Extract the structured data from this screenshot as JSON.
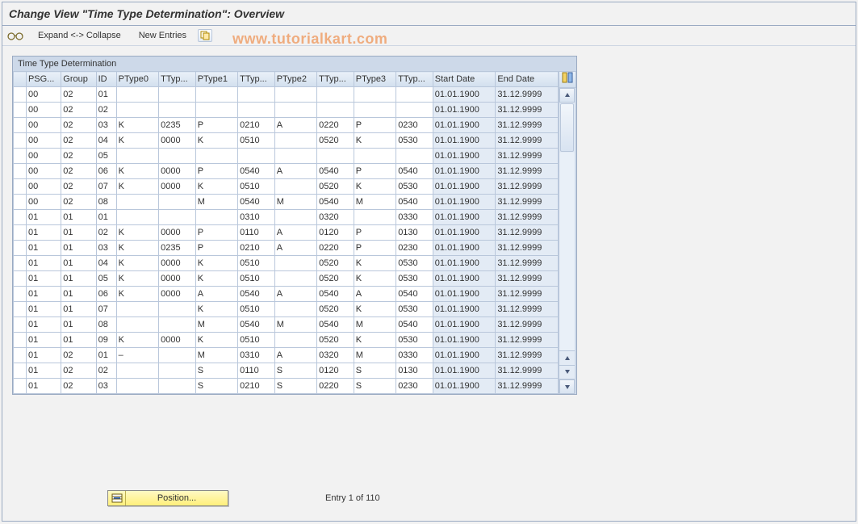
{
  "title": "Change View \"Time Type Determination\": Overview",
  "toolbar": {
    "expand_collapse": "Expand <-> Collapse",
    "new_entries": "New Entries"
  },
  "watermark": "www.tutorialkart.com",
  "panel_title": "Time Type Determination",
  "columns": [
    "PSG...",
    "Group",
    "ID",
    "PType0",
    "TTyp...",
    "PType1",
    "TTyp...",
    "PType2",
    "TTyp...",
    "PType3",
    "TTyp...",
    "Start Date",
    "End Date"
  ],
  "rows": [
    {
      "psg": "00",
      "group": "02",
      "id": "01",
      "pt0": "",
      "tt0": "",
      "pt1": "",
      "tt1": "",
      "pt2": "",
      "tt2": "",
      "pt3": "",
      "tt3": "",
      "start": "01.01.1900",
      "end": "31.12.9999"
    },
    {
      "psg": "00",
      "group": "02",
      "id": "02",
      "pt0": "",
      "tt0": "",
      "pt1": "",
      "tt1": "",
      "pt2": "",
      "tt2": "",
      "pt3": "",
      "tt3": "",
      "start": "01.01.1900",
      "end": "31.12.9999"
    },
    {
      "psg": "00",
      "group": "02",
      "id": "03",
      "pt0": "K",
      "tt0": "0235",
      "pt1": "P",
      "tt1": "0210",
      "pt2": "A",
      "tt2": "0220",
      "pt3": "P",
      "tt3": "0230",
      "start": "01.01.1900",
      "end": "31.12.9999"
    },
    {
      "psg": "00",
      "group": "02",
      "id": "04",
      "pt0": "K",
      "tt0": "0000",
      "pt1": "K",
      "tt1": "0510",
      "pt2": "",
      "tt2": "0520",
      "pt3": "K",
      "tt3": "0530",
      "start": "01.01.1900",
      "end": "31.12.9999"
    },
    {
      "psg": "00",
      "group": "02",
      "id": "05",
      "pt0": "",
      "tt0": "",
      "pt1": "",
      "tt1": "",
      "pt2": "",
      "tt2": "",
      "pt3": "",
      "tt3": "",
      "start": "01.01.1900",
      "end": "31.12.9999"
    },
    {
      "psg": "00",
      "group": "02",
      "id": "06",
      "pt0": "K",
      "tt0": "0000",
      "pt1": "P",
      "tt1": "0540",
      "pt2": "A",
      "tt2": "0540",
      "pt3": "P",
      "tt3": "0540",
      "start": "01.01.1900",
      "end": "31.12.9999"
    },
    {
      "psg": "00",
      "group": "02",
      "id": "07",
      "pt0": "K",
      "tt0": "0000",
      "pt1": "K",
      "tt1": "0510",
      "pt2": "",
      "tt2": "0520",
      "pt3": "K",
      "tt3": "0530",
      "start": "01.01.1900",
      "end": "31.12.9999"
    },
    {
      "psg": "00",
      "group": "02",
      "id": "08",
      "pt0": "",
      "tt0": "",
      "pt1": "M",
      "tt1": "0540",
      "pt2": "M",
      "tt2": "0540",
      "pt3": "M",
      "tt3": "0540",
      "start": "01.01.1900",
      "end": "31.12.9999"
    },
    {
      "psg": "01",
      "group": "01",
      "id": "01",
      "pt0": "",
      "tt0": "",
      "pt1": "",
      "tt1": "0310",
      "pt2": "",
      "tt2": "0320",
      "pt3": "",
      "tt3": "0330",
      "start": "01.01.1900",
      "end": "31.12.9999"
    },
    {
      "psg": "01",
      "group": "01",
      "id": "02",
      "pt0": "K",
      "tt0": "0000",
      "pt1": "P",
      "tt1": "0110",
      "pt2": "A",
      "tt2": "0120",
      "pt3": "P",
      "tt3": "0130",
      "start": "01.01.1900",
      "end": "31.12.9999"
    },
    {
      "psg": "01",
      "group": "01",
      "id": "03",
      "pt0": "K",
      "tt0": "0235",
      "pt1": "P",
      "tt1": "0210",
      "pt2": "A",
      "tt2": "0220",
      "pt3": "P",
      "tt3": "0230",
      "start": "01.01.1900",
      "end": "31.12.9999"
    },
    {
      "psg": "01",
      "group": "01",
      "id": "04",
      "pt0": "K",
      "tt0": "0000",
      "pt1": "K",
      "tt1": "0510",
      "pt2": "",
      "tt2": "0520",
      "pt3": "K",
      "tt3": "0530",
      "start": "01.01.1900",
      "end": "31.12.9999"
    },
    {
      "psg": "01",
      "group": "01",
      "id": "05",
      "pt0": "K",
      "tt0": "0000",
      "pt1": "K",
      "tt1": "0510",
      "pt2": "",
      "tt2": "0520",
      "pt3": "K",
      "tt3": "0530",
      "start": "01.01.1900",
      "end": "31.12.9999"
    },
    {
      "psg": "01",
      "group": "01",
      "id": "06",
      "pt0": "K",
      "tt0": "0000",
      "pt1": "A",
      "tt1": "0540",
      "pt2": "A",
      "tt2": "0540",
      "pt3": "A",
      "tt3": "0540",
      "start": "01.01.1900",
      "end": "31.12.9999"
    },
    {
      "psg": "01",
      "group": "01",
      "id": "07",
      "pt0": "",
      "tt0": "",
      "pt1": "K",
      "tt1": "0510",
      "pt2": "",
      "tt2": "0520",
      "pt3": "K",
      "tt3": "0530",
      "start": "01.01.1900",
      "end": "31.12.9999"
    },
    {
      "psg": "01",
      "group": "01",
      "id": "08",
      "pt0": "",
      "tt0": "",
      "pt1": "M",
      "tt1": "0540",
      "pt2": "M",
      "tt2": "0540",
      "pt3": "M",
      "tt3": "0540",
      "start": "01.01.1900",
      "end": "31.12.9999"
    },
    {
      "psg": "01",
      "group": "01",
      "id": "09",
      "pt0": "K",
      "tt0": "0000",
      "pt1": "K",
      "tt1": "0510",
      "pt2": "",
      "tt2": "0520",
      "pt3": "K",
      "tt3": "0530",
      "start": "01.01.1900",
      "end": "31.12.9999"
    },
    {
      "psg": "01",
      "group": "02",
      "id": "01",
      "pt0": "–",
      "tt0": "",
      "pt1": "M",
      "tt1": "0310",
      "pt2": "A",
      "tt2": "0320",
      "pt3": "M",
      "tt3": "0330",
      "start": "01.01.1900",
      "end": "31.12.9999"
    },
    {
      "psg": "01",
      "group": "02",
      "id": "02",
      "pt0": "",
      "tt0": "",
      "pt1": "S",
      "tt1": "0110",
      "pt2": "S",
      "tt2": "0120",
      "pt3": "S",
      "tt3": "0130",
      "start": "01.01.1900",
      "end": "31.12.9999"
    },
    {
      "psg": "01",
      "group": "02",
      "id": "03",
      "pt0": "",
      "tt0": "",
      "pt1": "S",
      "tt1": "0210",
      "pt2": "S",
      "tt2": "0220",
      "pt3": "S",
      "tt3": "0230",
      "start": "01.01.1900",
      "end": "31.12.9999"
    }
  ],
  "position_label": "Position...",
  "entry_status": "Entry 1 of 110"
}
